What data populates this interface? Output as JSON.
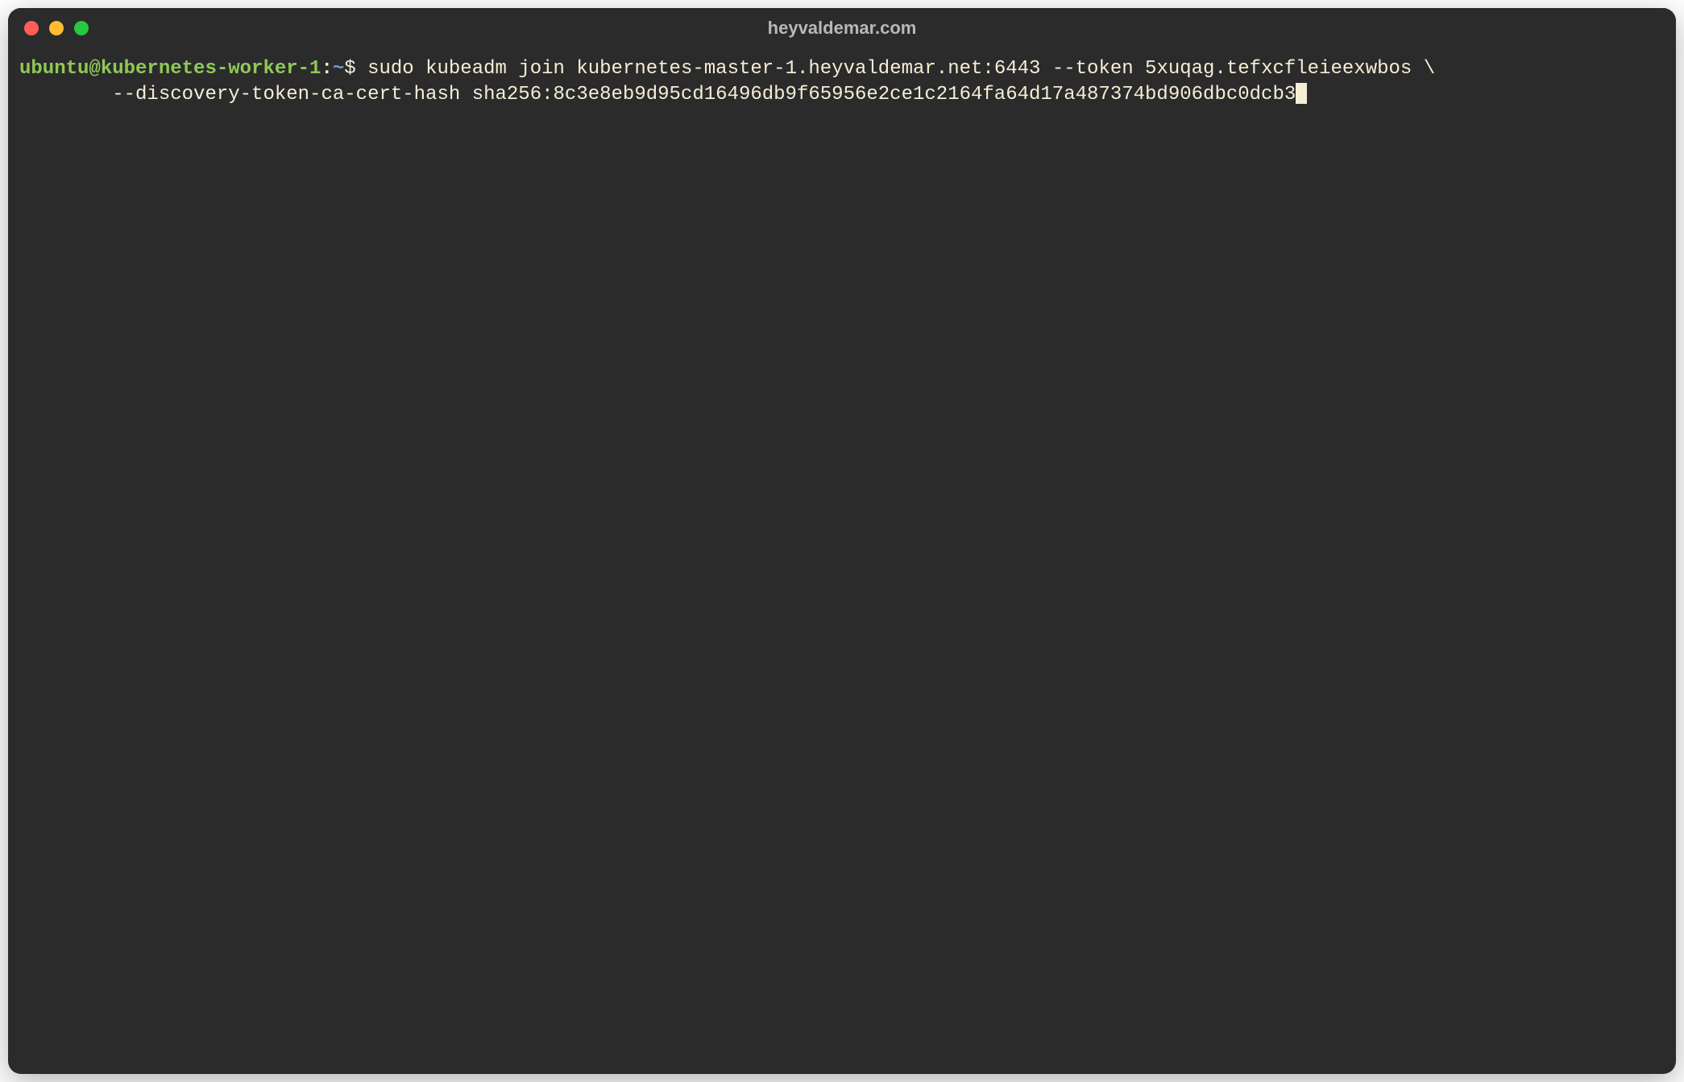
{
  "window": {
    "title": "heyvaldemar.com"
  },
  "prompt": {
    "user_host": "ubuntu@kubernetes-worker-1",
    "colon": ":",
    "path": "~",
    "symbol": "$"
  },
  "command": {
    "line1": " sudo kubeadm join kubernetes-master-1.heyvaldemar.net:6443 --token 5xuqag.tefxcfleieexwbos \\",
    "line2": "        --discovery-token-ca-cert-hash sha256:8c3e8eb9d95cd16496db9f65956e2ce1c2164fa64d17a487374bd906dbc0dcb3"
  },
  "colors": {
    "bg": "#2b2b2b",
    "text": "#f5edd6",
    "user": "#8fc956",
    "path": "#6a9fd4",
    "red": "#ff5f57",
    "yellow": "#febc2e",
    "green": "#28c840"
  }
}
